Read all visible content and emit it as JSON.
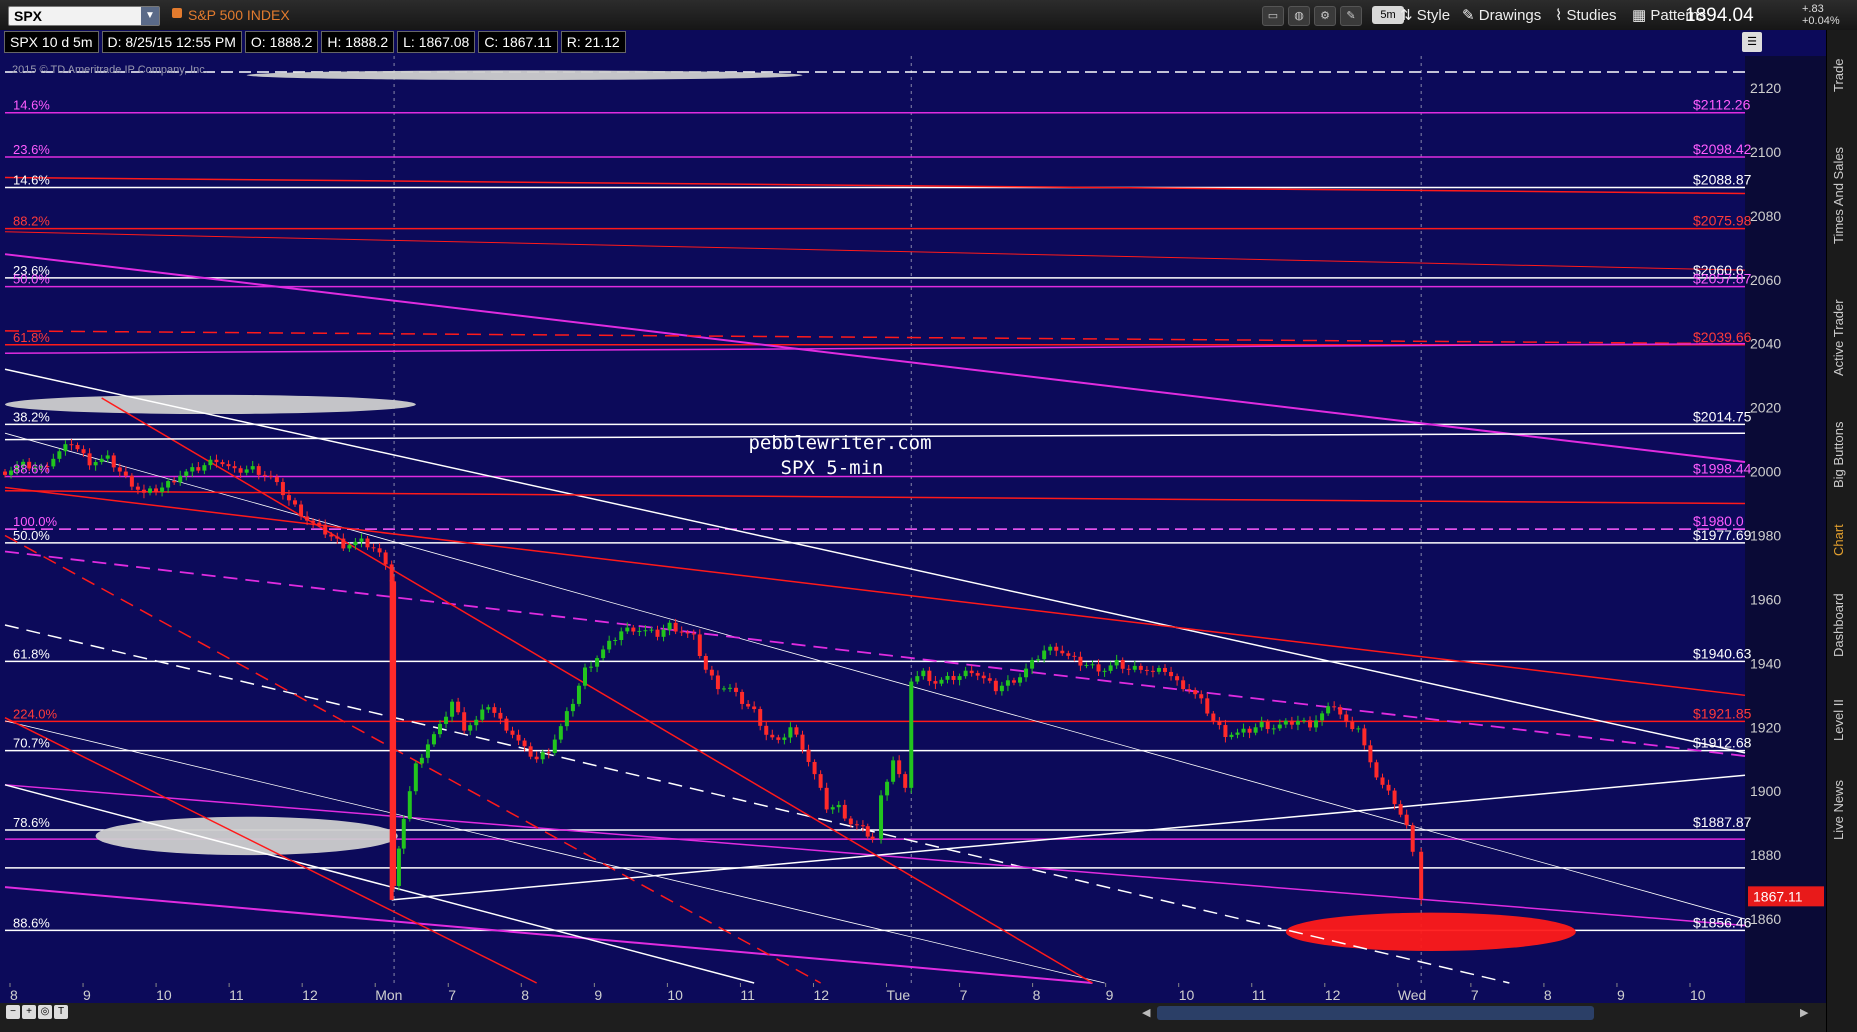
{
  "toolbar": {
    "symbol": "SPX",
    "symbol_name": "S&P 500 INDEX",
    "timeframe": "5m",
    "menus": [
      "Style",
      "Drawings",
      "Studies",
      "Patterns"
    ],
    "last_price": "1894.04",
    "change_abs": "+.83",
    "change_pct": "+0.04%"
  },
  "info": {
    "title": "SPX 10 d 5m",
    "date": "D: 8/25/15 12:55 PM",
    "open": "O: 1888.2",
    "high": "H: 1888.2",
    "low": "L: 1867.08",
    "close": "C: 1867.11",
    "range": "R: 21.12"
  },
  "copyright": "2015 © TD Ameritrade IP Company, Inc.",
  "watermark": [
    "pebblewriter.com",
    "SPX 5-min"
  ],
  "right_tabs": [
    "Trade",
    "Times And Sales",
    "Active Trader",
    "Big Buttons",
    "Chart",
    "Dashboard",
    "Level II",
    "Live News"
  ],
  "colors": {
    "background": "#0c0a5a",
    "magenta": "#e02ce0",
    "red": "#ff1a1a",
    "white": "#ffffff",
    "up_candle": "#22c51e",
    "down_candle": "#ff2a2a",
    "accent_orange": "#e37b2e"
  },
  "chart_data": {
    "type": "candlestick",
    "title": "SPX 10 d 5m",
    "ylim": [
      1840,
      2130
    ],
    "y_ticks": [
      1860,
      1880,
      1900,
      1920,
      1940,
      1960,
      1980,
      2000,
      2020,
      2040,
      2060,
      2080,
      2100,
      2120
    ],
    "x_labels": [
      "8",
      "9",
      "10",
      "11",
      "12",
      "Mon",
      "7",
      "8",
      "9",
      "10",
      "11",
      "12",
      "Tue",
      "7",
      "8",
      "9",
      "10",
      "11",
      "12",
      "Wed",
      "7",
      "8",
      "9",
      "10"
    ],
    "current_price_tag": "1867.11",
    "right_price_labels": [
      {
        "text": "$2112.26",
        "price": 2112.26,
        "color": "#ff5cff"
      },
      {
        "text": "$2098.42",
        "price": 2098.42,
        "color": "#ff5cff"
      },
      {
        "text": "$2088.87",
        "price": 2088.87,
        "color": "#ffffff"
      },
      {
        "text": "$2075.98",
        "price": 2075.98,
        "color": "#ff3a3a"
      },
      {
        "text": "$2060.6",
        "price": 2060.6,
        "color": "#ffffff"
      },
      {
        "text": "$2057.87",
        "price": 2057.87,
        "color": "#ff5cff"
      },
      {
        "text": "$2039.66",
        "price": 2039.66,
        "color": "#ff3a3a"
      },
      {
        "text": "$2014.75",
        "price": 2014.75,
        "color": "#ffffff"
      },
      {
        "text": "$1998.44",
        "price": 1998.44,
        "color": "#ff5cff"
      },
      {
        "text": "$1980.0",
        "price": 1982.0,
        "color": "#ff5cff"
      },
      {
        "text": "$1977.69",
        "price": 1977.69,
        "color": "#ffffff"
      },
      {
        "text": "$1940.63",
        "price": 1940.63,
        "color": "#ffffff"
      },
      {
        "text": "$1921.85",
        "price": 1921.85,
        "color": "#ff3a3a"
      },
      {
        "text": "$1912.68",
        "price": 1912.68,
        "color": "#ffffff"
      },
      {
        "text": "$1887.87",
        "price": 1887.87,
        "color": "#ffffff"
      },
      {
        "text": "$1856.46",
        "price": 1856.46,
        "color": "#ffffff"
      }
    ],
    "left_fib_labels": [
      {
        "text": "14.6%",
        "price": 2112.26,
        "color": "#ff5cff"
      },
      {
        "text": "23.6%",
        "price": 2098.42,
        "color": "#ff5cff"
      },
      {
        "text": "14.6%",
        "price": 2088.87,
        "color": "#ffffff"
      },
      {
        "text": "88.2%",
        "price": 2075.98,
        "color": "#ff3a3a"
      },
      {
        "text": "23.6%",
        "price": 2060.6,
        "color": "#ffffff"
      },
      {
        "text": "50.0%",
        "price": 2057.87,
        "color": "#ff5cff"
      },
      {
        "text": "61.8%",
        "price": 2039.66,
        "color": "#ff3a3a"
      },
      {
        "text": "38.2%",
        "price": 2014.75,
        "color": "#ffffff"
      },
      {
        "text": "88.6%",
        "price": 1998.44,
        "color": "#ff5cff"
      },
      {
        "text": "100.0%",
        "price": 1982.0,
        "color": "#ff5cff"
      },
      {
        "text": "50.0%",
        "price": 1977.69,
        "color": "#ffffff"
      },
      {
        "text": "61.8%",
        "price": 1940.63,
        "color": "#ffffff"
      },
      {
        "text": "224.0%",
        "price": 1921.85,
        "color": "#ff3a3a"
      },
      {
        "text": "70.7%",
        "price": 1912.68,
        "color": "#ffffff"
      },
      {
        "text": "78.6%",
        "price": 1887.87,
        "color": "#ffffff"
      },
      {
        "text": "88.6%",
        "price": 1856.46,
        "color": "#ffffff"
      }
    ],
    "horizontal_levels": [
      {
        "price": 2112.26,
        "color": "#e02ce0",
        "dash": false
      },
      {
        "price": 2098.42,
        "color": "#e02ce0",
        "dash": false
      },
      {
        "price": 2088.87,
        "color": "#ffffff",
        "dash": false
      },
      {
        "price": 2075.98,
        "color": "#ff1a1a",
        "dash": false
      },
      {
        "price": 2060.6,
        "color": "#ffffff",
        "dash": false
      },
      {
        "price": 2057.87,
        "color": "#e02ce0",
        "dash": false
      },
      {
        "price": 2039.66,
        "color": "#ff1a1a",
        "dash": false
      },
      {
        "price": 2014.75,
        "color": "#ffffff",
        "dash": false
      },
      {
        "price": 1998.44,
        "color": "#e02ce0",
        "dash": false
      },
      {
        "price": 1982.0,
        "color": "#ff5cff",
        "dash": true
      },
      {
        "price": 1977.69,
        "color": "#ffffff",
        "dash": false
      },
      {
        "price": 1940.63,
        "color": "#ffffff",
        "dash": false
      },
      {
        "price": 1921.85,
        "color": "#ff1a1a",
        "dash": false
      },
      {
        "price": 1912.68,
        "color": "#ffffff",
        "dash": false
      },
      {
        "price": 1887.87,
        "color": "#ffffff",
        "dash": false
      },
      {
        "price": 1885.0,
        "color": "#e02ce0",
        "dash": false
      },
      {
        "price": 1876.0,
        "color": "#ffffff",
        "dash": false
      },
      {
        "price": 1856.46,
        "color": "#ffffff",
        "dash": false
      },
      {
        "price": 2125.0,
        "color": "#ffffff",
        "dash": true
      }
    ],
    "trend_lines": [
      {
        "from": [
          0,
          2068
        ],
        "to": [
          1440,
          2003
        ],
        "color": "#e02ce0",
        "width": 2,
        "dash": false
      },
      {
        "from": [
          0,
          2092
        ],
        "to": [
          1440,
          2087
        ],
        "color": "#ff1a1a",
        "width": 1.5,
        "dash": false
      },
      {
        "from": [
          0,
          2075
        ],
        "to": [
          1440,
          2063
        ],
        "color": "#ff1a1a",
        "width": 1,
        "dash": false
      },
      {
        "from": [
          0,
          2032
        ],
        "to": [
          1440,
          1912
        ],
        "color": "#ffffff",
        "width": 1.5,
        "dash": false
      },
      {
        "from": [
          0,
          2012
        ],
        "to": [
          1440,
          1860
        ],
        "color": "#ffffff",
        "width": 0.8,
        "dash": false
      },
      {
        "from": [
          0,
          1995
        ],
        "to": [
          1440,
          1930
        ],
        "color": "#ff1a1a",
        "width": 1.5,
        "dash": false
      },
      {
        "from": [
          0,
          1975
        ],
        "to": [
          1440,
          1911
        ],
        "color": "#e02ce0",
        "width": 1.8,
        "dash": true
      },
      {
        "from": [
          0,
          1952
        ],
        "to": [
          1245,
          1840
        ],
        "color": "#ffffff",
        "width": 1.5,
        "dash": true
      },
      {
        "from": [
          0,
          1902
        ],
        "to": [
          1440,
          1858
        ],
        "color": "#e02ce0",
        "width": 1.5,
        "dash": false
      },
      {
        "from": [
          0,
          1870
        ],
        "to": [
          900,
          1840
        ],
        "color": "#e02ce0",
        "width": 2,
        "dash": false
      },
      {
        "from": [
          0,
          1902
        ],
        "to": [
          620,
          1840
        ],
        "color": "#ffffff",
        "width": 1.5,
        "dash": false
      },
      {
        "from": [
          0,
          1922
        ],
        "to": [
          910,
          1840
        ],
        "color": "#ffffff",
        "width": 0.8,
        "dash": false
      },
      {
        "from": [
          320,
          1866
        ],
        "to": [
          1440,
          1905
        ],
        "color": "#ffffff",
        "width": 1.5,
        "dash": false
      },
      {
        "from": [
          80,
          2023
        ],
        "to": [
          900,
          1840
        ],
        "color": "#ff1a1a",
        "width": 1.5,
        "dash": false
      },
      {
        "from": [
          0,
          1980
        ],
        "to": [
          675,
          1840
        ],
        "color": "#ff1a1a",
        "width": 1.5,
        "dash": true
      },
      {
        "from": [
          0,
          1923
        ],
        "to": [
          440,
          1840
        ],
        "color": "#ff1a1a",
        "width": 1.5,
        "dash": false
      },
      {
        "from": [
          0,
          2044
        ],
        "to": [
          1440,
          2040
        ],
        "color": "#ff1a1a",
        "width": 1.5,
        "dash": true
      },
      {
        "from": [
          0,
          2037
        ],
        "to": [
          1440,
          2040
        ],
        "color": "#e02ce0",
        "width": 1.5,
        "dash": false
      },
      {
        "from": [
          0,
          2010
        ],
        "to": [
          1440,
          2012
        ],
        "color": "#ffffff",
        "width": 1.5,
        "dash": false
      },
      {
        "from": [
          0,
          1994
        ],
        "to": [
          1440,
          1990
        ],
        "color": "#ff1a1a",
        "width": 1.5,
        "dash": false
      }
    ],
    "ellipses": [
      {
        "cx": 170,
        "cy_price": 2021,
        "rx": 170,
        "ry_price": 3,
        "color": "#cfcfcf"
      },
      {
        "cx": 430,
        "cy_price": 2124,
        "rx": 230,
        "ry_price": 1.5,
        "color": "#cfcfcf"
      },
      {
        "cx": 200,
        "cy_price": 1886,
        "rx": 125,
        "ry_price": 6,
        "color": "#cfcfcf"
      },
      {
        "cx": 1180,
        "cy_price": 1856,
        "rx": 120,
        "ry_price": 6,
        "color": "#ff1a1a"
      }
    ],
    "candle_path": [
      [
        0,
        2000
      ],
      [
        15,
        2002
      ],
      [
        30,
        2001
      ],
      [
        45,
        2006
      ],
      [
        55,
        2009
      ],
      [
        70,
        2003
      ],
      [
        85,
        2004
      ],
      [
        100,
        1998
      ],
      [
        115,
        1993
      ],
      [
        130,
        1995
      ],
      [
        145,
        1999
      ],
      [
        160,
        2001
      ],
      [
        175,
        2004
      ],
      [
        190,
        2000
      ],
      [
        205,
        2001
      ],
      [
        220,
        1998
      ],
      [
        235,
        1991
      ],
      [
        250,
        1985
      ],
      [
        265,
        1981
      ],
      [
        280,
        1977
      ],
      [
        295,
        1978
      ],
      [
        305,
        1976
      ],
      [
        315,
        1972
      ],
      [
        320,
        1966
      ],
      [
        322,
        1870
      ],
      [
        330,
        1892
      ],
      [
        340,
        1908
      ],
      [
        350,
        1915
      ],
      [
        360,
        1920
      ],
      [
        370,
        1928
      ],
      [
        380,
        1920
      ],
      [
        390,
        1922
      ],
      [
        400,
        1927
      ],
      [
        410,
        1922
      ],
      [
        420,
        1918
      ],
      [
        430,
        1913
      ],
      [
        440,
        1910
      ],
      [
        450,
        1913
      ],
      [
        460,
        1920
      ],
      [
        470,
        1928
      ],
      [
        480,
        1938
      ],
      [
        490,
        1942
      ],
      [
        500,
        1946
      ],
      [
        510,
        1950
      ],
      [
        520,
        1951
      ],
      [
        530,
        1950
      ],
      [
        540,
        1949
      ],
      [
        550,
        1952
      ],
      [
        560,
        1950
      ],
      [
        570,
        1948
      ],
      [
        580,
        1938
      ],
      [
        590,
        1933
      ],
      [
        600,
        1932
      ],
      [
        610,
        1928
      ],
      [
        620,
        1925
      ],
      [
        630,
        1918
      ],
      [
        640,
        1915
      ],
      [
        650,
        1920
      ],
      [
        660,
        1914
      ],
      [
        670,
        1905
      ],
      [
        680,
        1895
      ],
      [
        690,
        1895
      ],
      [
        700,
        1890
      ],
      [
        710,
        1888
      ],
      [
        718,
        1885
      ],
      [
        725,
        1898
      ],
      [
        735,
        1910
      ],
      [
        745,
        1900
      ],
      [
        750,
        1935
      ],
      [
        760,
        1937
      ],
      [
        770,
        1934
      ],
      [
        780,
        1935
      ],
      [
        790,
        1936
      ],
      [
        800,
        1938
      ],
      [
        810,
        1935
      ],
      [
        820,
        1932
      ],
      [
        830,
        1934
      ],
      [
        840,
        1936
      ],
      [
        850,
        1940
      ],
      [
        860,
        1944
      ],
      [
        870,
        1945
      ],
      [
        880,
        1942
      ],
      [
        890,
        1940
      ],
      [
        900,
        1939
      ],
      [
        910,
        1938
      ],
      [
        920,
        1940
      ],
      [
        930,
        1938
      ],
      [
        940,
        1939
      ],
      [
        950,
        1937
      ],
      [
        960,
        1938
      ],
      [
        970,
        1934
      ],
      [
        980,
        1932
      ],
      [
        990,
        1928
      ],
      [
        1000,
        1922
      ],
      [
        1010,
        1918
      ],
      [
        1020,
        1918
      ],
      [
        1030,
        1919
      ],
      [
        1040,
        1921
      ],
      [
        1050,
        1920
      ],
      [
        1060,
        1921
      ],
      [
        1070,
        1922
      ],
      [
        1080,
        1921
      ],
      [
        1090,
        1924
      ],
      [
        1100,
        1927
      ],
      [
        1110,
        1921
      ],
      [
        1120,
        1920
      ],
      [
        1130,
        1908
      ],
      [
        1140,
        1902
      ],
      [
        1150,
        1897
      ],
      [
        1160,
        1889
      ],
      [
        1165,
        1880
      ],
      [
        1172,
        1867
      ]
    ]
  }
}
